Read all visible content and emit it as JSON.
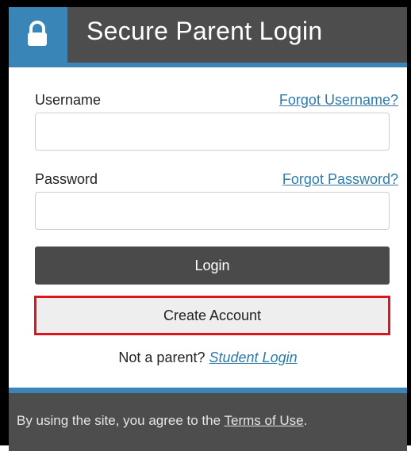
{
  "header": {
    "title": "Secure Parent Login",
    "icon": "lock-icon"
  },
  "form": {
    "username_label": "Username",
    "forgot_username": "Forgot Username?",
    "username_value": "",
    "password_label": "Password",
    "forgot_password": "Forgot Password?",
    "password_value": "",
    "login_button": "Login",
    "create_account_button": "Create Account",
    "not_parent_text": "Not a parent?",
    "student_login_link": "Student Login"
  },
  "footer": {
    "text_before": "By using the site, you agree to the",
    "terms_link": "Terms of Use",
    "text_after": "."
  },
  "colors": {
    "header_bg": "#4d4d4d",
    "accent_blue": "#3a85b7",
    "link": "#2f7aa8",
    "highlight_border": "#e0141e"
  }
}
